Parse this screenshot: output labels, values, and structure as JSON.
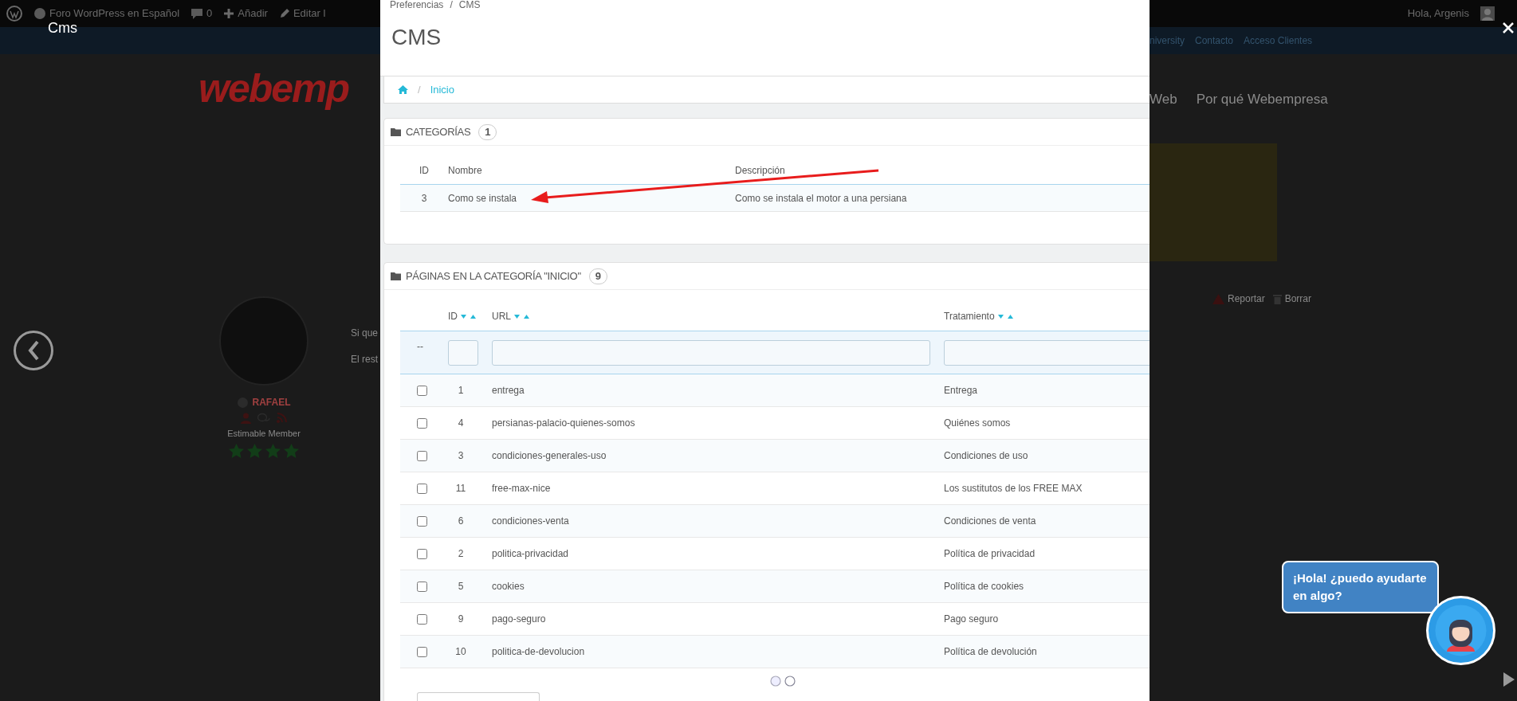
{
  "lightbox": {
    "title": "Cms"
  },
  "background_page": {
    "admin_bar": {
      "site": "Foro WordPress en Español",
      "comments": "0",
      "add": "Añadir",
      "edit": "Editar l",
      "greeting": "Hola, Argenis"
    },
    "top_links": [
      "niversity",
      "Contacto",
      "Acceso Clientes"
    ],
    "logo": "webemp",
    "menu": [
      "Web",
      "Por qué Webempresa"
    ],
    "post": {
      "author": "RAFAEL",
      "rank": "Estimable Member",
      "stars": 4,
      "lines": [
        "Si que",
        "El rest"
      ],
      "actions": [
        "Reportar",
        "Borrar"
      ]
    }
  },
  "screenshot": {
    "breadcrumb": [
      "Preferencias",
      "CMS"
    ],
    "breadcrumb_separator": "/",
    "title": "CMS",
    "nav_separator": "/",
    "nav": [
      "Inicio"
    ],
    "categories": {
      "title": "CATEGORÍAS",
      "count": "1",
      "columns": [
        "ID",
        "Nombre",
        "Descripción"
      ],
      "rows": [
        [
          "3",
          "Como se instala",
          "Como se instala el motor a una persiana"
        ]
      ]
    },
    "pages": {
      "title": "PÁGINAS EN LA CATEGORÍA \"INICIO\"",
      "count": "9",
      "columns": [
        "ID",
        "URL",
        "Tratamiento"
      ],
      "filter_reset": "--",
      "rows": [
        {
          "checked": false,
          "id": "1",
          "url": "entrega",
          "title": "Entrega"
        },
        {
          "checked": false,
          "id": "4",
          "url": "persianas-palacio-quienes-somos",
          "title": "Quiénes somos"
        },
        {
          "checked": false,
          "id": "3",
          "url": "condiciones-generales-uso",
          "title": "Condiciones de uso"
        },
        {
          "checked": false,
          "id": "11",
          "url": "free-max-nice",
          "title": "Los sustitutos de los FREE MAX"
        },
        {
          "checked": false,
          "id": "6",
          "url": "condiciones-venta",
          "title": "Condiciones de venta"
        },
        {
          "checked": false,
          "id": "2",
          "url": "politica-privacidad",
          "title": "Política de privacidad"
        },
        {
          "checked": false,
          "id": "5",
          "url": "cookies",
          "title": "Política de cookies"
        },
        {
          "checked": false,
          "id": "9",
          "url": "pago-seguro",
          "title": "Pago seguro"
        },
        {
          "checked": false,
          "id": "10",
          "url": "politica-de-devolucion",
          "title": "Política de devolución"
        }
      ]
    }
  },
  "chat": {
    "message": "¡Hola! ¿puedo ayudarte en algo?"
  }
}
